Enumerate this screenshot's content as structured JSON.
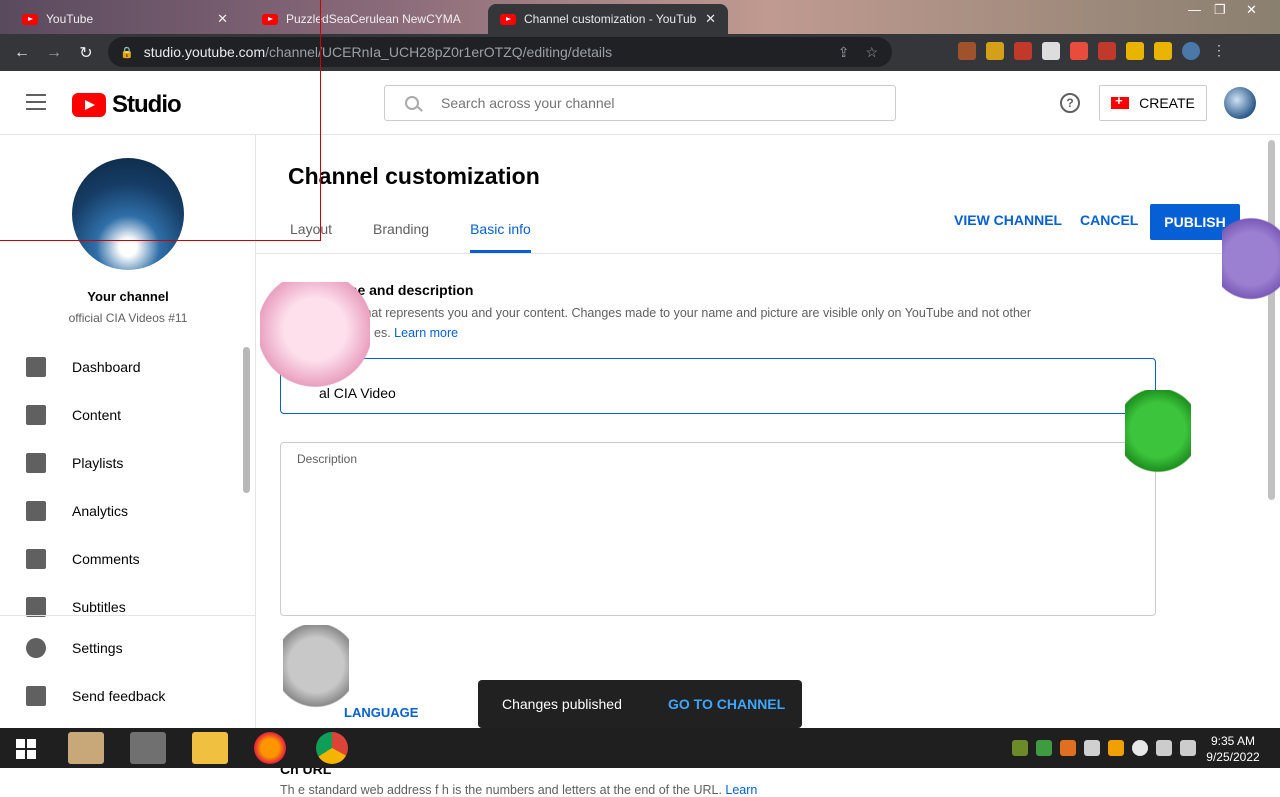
{
  "browser": {
    "tabs": [
      {
        "label": "YouTube",
        "active": false
      },
      {
        "label": "PuzzledSeaCerulean NewCYMA",
        "active": false
      },
      {
        "label": "Channel customization - YouTub",
        "active": true
      }
    ],
    "url_host": "studio.youtube.com",
    "url_path": "/channel/UCERnIa_UCH28pZ0r1erOTZQ/editing/details"
  },
  "masthead": {
    "logo_text": "Studio",
    "search_placeholder": "Search across your channel",
    "help_glyph": "?",
    "create_label": "CREATE"
  },
  "sidebar": {
    "your_channel": "Your channel",
    "channel_name": "official CIA Videos #11",
    "items": [
      {
        "label": "Dashboard",
        "icon": "dashboard-icon"
      },
      {
        "label": "Content",
        "icon": "content-icon"
      },
      {
        "label": "Playlists",
        "icon": "playlists-icon"
      },
      {
        "label": "Analytics",
        "icon": "analytics-icon"
      },
      {
        "label": "Comments",
        "icon": "comments-icon"
      },
      {
        "label": "Subtitles",
        "icon": "subtitles-icon"
      }
    ],
    "settings_label": "Settings",
    "feedback_label": "Send feedback"
  },
  "main": {
    "title": "Channel customization",
    "tabs": [
      "Layout",
      "Branding",
      "Basic info"
    ],
    "active_tab": "Basic info",
    "view_channel": "VIEW CHANNEL",
    "cancel": "CANCEL",
    "publish": "PUBLISH",
    "section_title": "nnel name and description",
    "section_desc": "nel name that represents you and your content. Changes made to your name and picture are visible only on YouTube and not other",
    "section_desc_2": "es.",
    "learn_more": "Learn more",
    "name_value": "al CIA Video",
    "description_label": "Description",
    "description_value": "",
    "language_link": "LANGUAGE",
    "url_title": "Ch         URL",
    "url_desc": "Th          e standard web address f                                                              h is the numbers and letters at the end of the URL.",
    "url_learn": "Learn"
  },
  "toast": {
    "message": "Changes published",
    "action": "GO TO CHANNEL"
  },
  "taskbar": {
    "time": "9:35 AM",
    "date": "9/25/2022"
  },
  "colors": {
    "accent": "#065fd4",
    "brand_red": "#ff0000",
    "toast_bg": "#212121"
  }
}
